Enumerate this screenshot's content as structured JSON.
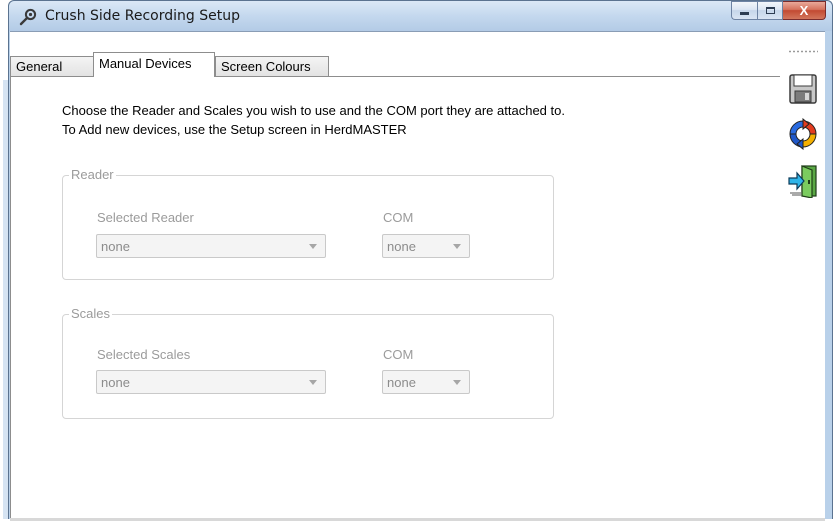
{
  "window": {
    "title": "Crush Side Recording Setup",
    "icon": "wrench-icon"
  },
  "caption_buttons": {
    "minimize": "minimize-icon",
    "maximize": "maximize-icon",
    "close_label": "X"
  },
  "tabs": [
    {
      "label": "General",
      "active": false
    },
    {
      "label": "Manual Devices",
      "active": true
    },
    {
      "label": "Screen Colours",
      "active": false
    }
  ],
  "instructions": [
    "Choose the Reader and Scales you wish to use and the COM port they are attached to.",
    "To Add new devices, use the Setup screen in HerdMASTER"
  ],
  "reader": {
    "legend": "Reader",
    "device_label": "Selected Reader",
    "device_value": "none",
    "com_label": "COM",
    "com_value": "none"
  },
  "scales": {
    "legend": "Scales",
    "device_label": "Selected Scales",
    "device_value": "none",
    "com_label": "COM",
    "com_value": "none"
  },
  "toolbar": [
    {
      "icon": "save-icon"
    },
    {
      "icon": "refresh-icon"
    },
    {
      "icon": "exit-icon"
    }
  ],
  "colors": {
    "title_bar": "#c4d8ee",
    "close_button": "#c24a32",
    "disabled_text": "#9b9b9b"
  }
}
